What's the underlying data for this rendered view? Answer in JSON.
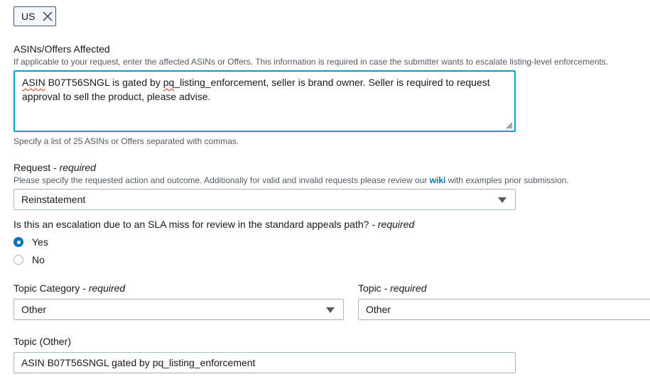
{
  "chip": {
    "label": "US"
  },
  "asins": {
    "label": "ASINs/Offers Affected",
    "description": "If applicable to your request, enter the affected ASINs or Offers. This information is required in case the submitter wants to escalate listing-level enforcements.",
    "value_word1": "ASIN",
    "value_part2": " B07T56SNGL is gated by ",
    "value_word2": "pq",
    "value_part3": "_listing_enforcement, seller is brand owner. Seller is required to request approval to sell the product, please advise.",
    "hint": "Specify a list of 25 ASINs or Offers separated with commas."
  },
  "request": {
    "label": "Request",
    "required": "- required",
    "description_before": "Please specify the requested action and outcome. Additionally for valid and invalid requests please review our ",
    "wiki_link": "wiki",
    "description_after": " with examples prior submission.",
    "selected": "Reinstatement"
  },
  "sla": {
    "question": "Is this an escalation due to an SLA miss for review in the standard appeals path?",
    "required": "- required",
    "options": [
      {
        "label": "Yes",
        "selected": true
      },
      {
        "label": "No",
        "selected": false
      }
    ]
  },
  "topic_category": {
    "label": "Topic Category",
    "required": "- required",
    "selected": "Other"
  },
  "topic": {
    "label": "Topic",
    "required": "- required",
    "selected": "Other"
  },
  "topic_other": {
    "label": "Topic (Other)",
    "value": "ASIN B07T56SNGL gated by pq_listing_enforcement"
  },
  "colors": {
    "accent": "#0073bb",
    "focus_border": "#00a1c9",
    "border": "#aab7b8",
    "text": "#16191f",
    "muted": "#545b64"
  }
}
